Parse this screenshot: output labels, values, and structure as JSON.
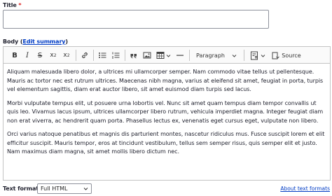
{
  "title_field": {
    "label": "Title",
    "required_mark": "*",
    "value": ""
  },
  "body_field": {
    "label": "Body",
    "open_paren": "(",
    "edit_summary": "Edit summary",
    "close_paren": ")"
  },
  "toolbar": {
    "bold": "B",
    "italic": "I",
    "strike": "S",
    "superscript_base": "x",
    "superscript_mark": "2",
    "subscript_base": "x",
    "subscript_mark": "2",
    "heading_select": "Paragraph",
    "source_label": "Source"
  },
  "content": {
    "paragraphs": [
      "Aliquam malesuada libero dolor, a ultrices mi ullamcorper semper. Nam commodo vitae tellus ut pellentesque. Mauris ac tortor nec est rutrum ultrices. Maecenas nibh magna, varius at eleifend sit amet, feugiat in porta, turpis vel elementum sagittis, diam erat auctor libero, sit amet euismod diam turpis sed lacus.",
      "Morbi vulputate tempus elit, ut posuere urna lobortis vel. Nunc sit amet quam tempus diam tempor convallis ut quis leo. Vivamus lacus ipsum, ultrices ullamcorper libero rutrum, vehicula imperdiet magna. Integer feugiat diam non erat viverra, ac hendrerit quam porta. Phasellus lectus ex, venenatis eget cursus eget, vulputate non libero.",
      "Orci varius natoque penatibus et magnis dis parturient montes, nascetur ridiculus mus. Fusce suscipit lorem et elit efficitur suscipit. Mauris tempor, eros at tincidunt vestibulum, tellus sem semper risus, quis semper elit et justo. Nam maximus diam magna, sit amet mollis libero dictum nec."
    ]
  },
  "text_format": {
    "label": "Text format",
    "selected": "Full HTML",
    "about_link": "About text formats"
  },
  "colors": {
    "link": "#003cc5",
    "required": "#dc2323",
    "border": "#c4c4c4",
    "text": "#222330"
  }
}
